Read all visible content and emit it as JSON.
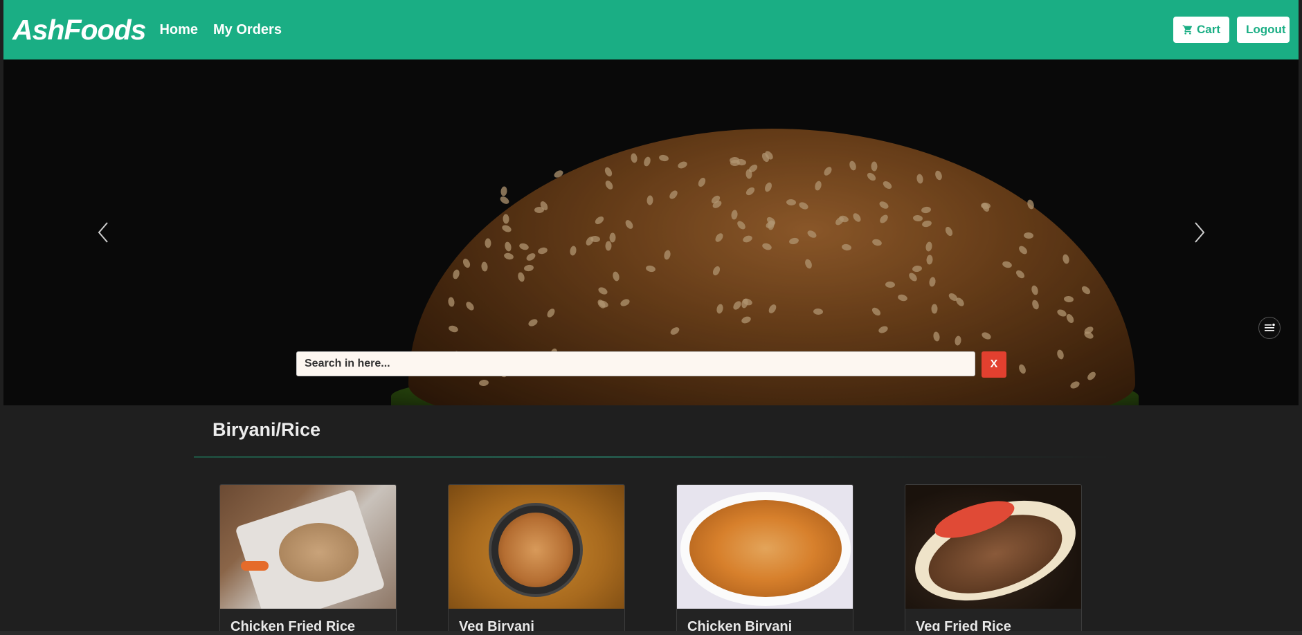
{
  "navbar": {
    "brand": "AshFoods",
    "links": [
      "Home",
      "My Orders"
    ],
    "cart_label": "Cart",
    "logout_label": "Logout",
    "accent_color": "#1aae84"
  },
  "hero": {
    "icons": [
      "chevron-left-icon",
      "chevron-right-icon",
      "menu-icon"
    ]
  },
  "search": {
    "placeholder": "Search in here...",
    "value": "",
    "clear_label": "X",
    "clear_color": "#e2402f"
  },
  "category": {
    "title": "Biryani/Rice",
    "items": [
      {
        "name": "Chicken Fried Rice"
      },
      {
        "name": "Veg Biryani"
      },
      {
        "name": "Chicken Biryani"
      },
      {
        "name": "Veg Fried Rice"
      }
    ]
  }
}
